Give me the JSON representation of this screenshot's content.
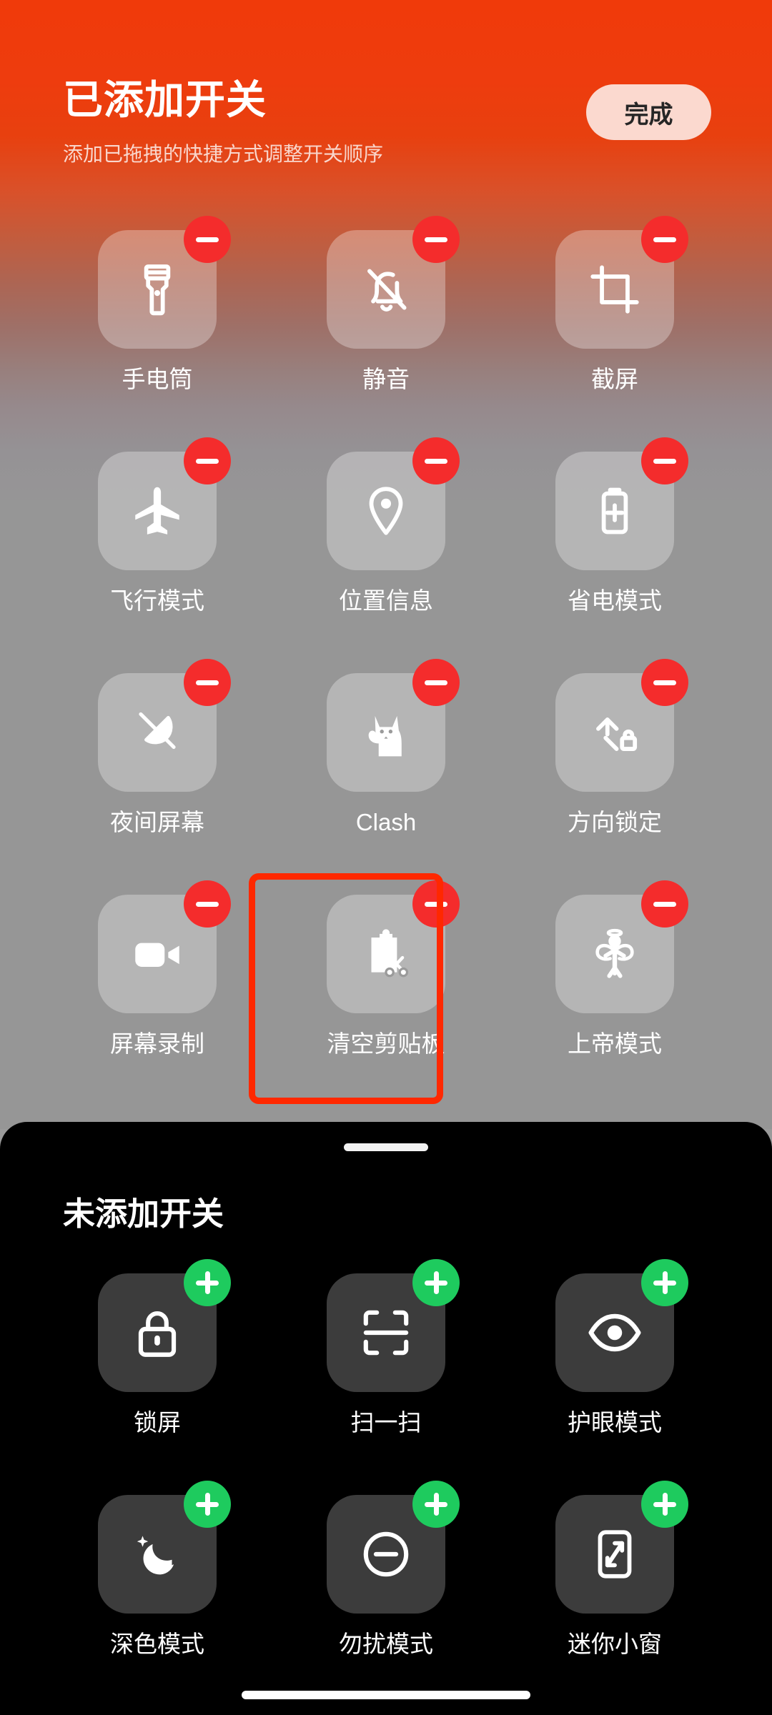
{
  "header": {
    "title": "已添加开关",
    "subtitle": "添加已拖拽的快捷方式调整开关顺序",
    "done_label": "完成"
  },
  "colors": {
    "gradient_top": "#f03a0a",
    "gradient_bottom": "#969696",
    "remove_badge": "#f42c2c",
    "add_badge": "#1ecb5e",
    "done_button_bg": "#fbd9cf",
    "done_button_text": "#262626",
    "sheet_bg": "#000000",
    "tile_bg_added": "rgba(255,255,255,0.30)",
    "tile_bg_unadded": "#3c3c3c",
    "highlight_border": "#ff2800"
  },
  "added_section": {
    "badge_icon": "minus-circle-icon",
    "tiles": [
      {
        "label": "手电筒",
        "icon": "flashlight-icon"
      },
      {
        "label": "静音",
        "icon": "bell-muted-icon"
      },
      {
        "label": "截屏",
        "icon": "crop-screenshot-icon"
      },
      {
        "label": "飞行模式",
        "icon": "airplane-icon"
      },
      {
        "label": "位置信息",
        "icon": "location-pin-icon"
      },
      {
        "label": "省电模式",
        "icon": "battery-saver-icon"
      },
      {
        "label": "夜间屏幕",
        "icon": "night-screen-off-icon"
      },
      {
        "label": "Clash",
        "icon": "cat-icon"
      },
      {
        "label": "方向锁定",
        "icon": "rotation-lock-icon"
      },
      {
        "label": "屏幕录制",
        "icon": "video-camera-icon"
      },
      {
        "label": "清空剪贴板",
        "icon": "clipboard-scissors-icon"
      },
      {
        "label": "上帝模式",
        "icon": "angel-icon"
      }
    ],
    "highlighted_tile_label": "清空剪贴板"
  },
  "sheet": {
    "title": "未添加开关",
    "badge_icon": "plus-circle-icon",
    "handle_icon": "drag-handle-icon",
    "tiles": [
      {
        "label": "锁屏",
        "icon": "lock-icon"
      },
      {
        "label": "扫一扫",
        "icon": "scan-icon"
      },
      {
        "label": "护眼模式",
        "icon": "eye-icon"
      },
      {
        "label": "深色模式",
        "icon": "moon-stars-icon"
      },
      {
        "label": "勿扰模式",
        "icon": "minus-circle-outline-icon"
      },
      {
        "label": "迷你小窗",
        "icon": "mini-window-icon"
      }
    ]
  },
  "system": {
    "home_indicator": "home-indicator"
  }
}
